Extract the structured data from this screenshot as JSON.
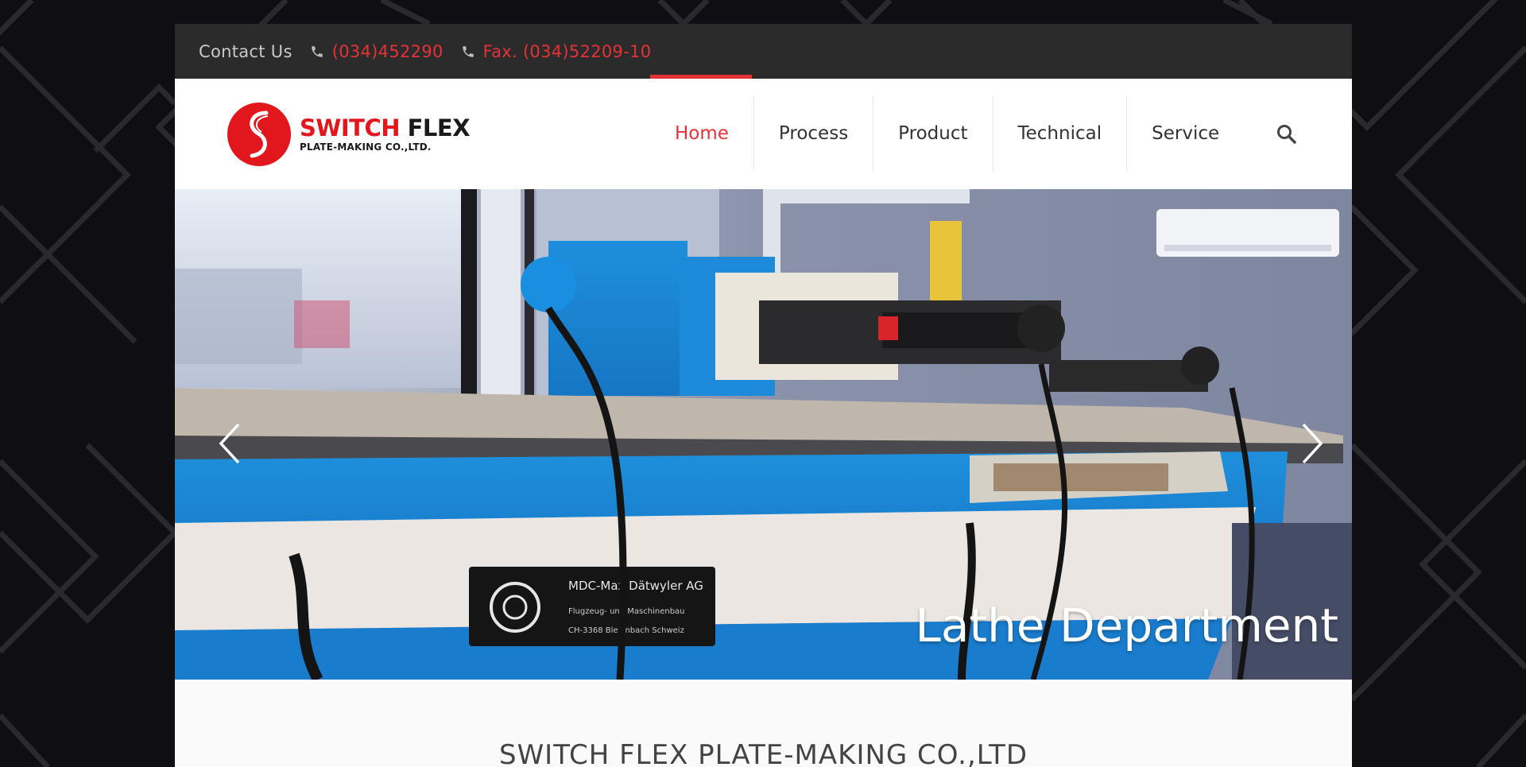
{
  "topbar": {
    "contact_label": "Contact Us",
    "phone": "(034)452290",
    "fax": "Fax. (034)52209-10"
  },
  "logo": {
    "brand_red": "SWITCH",
    "brand_dark": "FLEX",
    "subtitle": "PLATE-MAKING CO.,LTD."
  },
  "nav": {
    "items": [
      {
        "label": "Home",
        "active": true
      },
      {
        "label": "Process",
        "active": false
      },
      {
        "label": "Product",
        "active": false
      },
      {
        "label": "Technical",
        "active": false
      },
      {
        "label": "Service",
        "active": false
      }
    ]
  },
  "hero": {
    "title": "Lathe Department",
    "machine_plate": {
      "line1": "MDC-Max Dätwyler AG",
      "line2": "Flugzeug- und Maschinenbau",
      "line3": "CH-3368 Bleienbach   Schweiz"
    }
  },
  "company_name": "SWITCH FLEX PLATE-MAKING CO.,LTD",
  "colors": {
    "accent": "#e53237",
    "topbar_bg": "#2b2b2b",
    "page_bg": "#0f0e12"
  },
  "icons": [
    "phone-icon",
    "search-icon",
    "chevron-left-icon",
    "chevron-right-icon"
  ]
}
